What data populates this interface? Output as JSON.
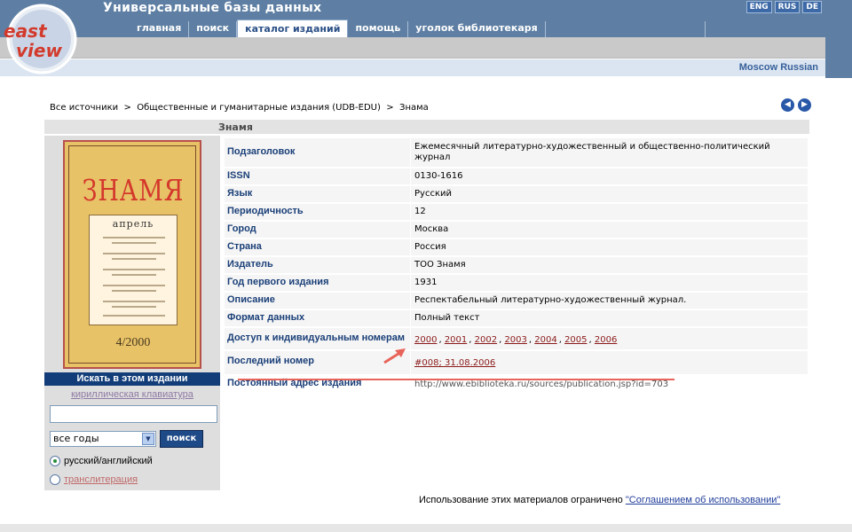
{
  "header": {
    "site_title": "Универсальные базы данных",
    "languages": [
      "ENG",
      "RUS",
      "DE"
    ],
    "nav": [
      "главная",
      "поиск",
      "каталог изданий",
      "помощь",
      "уголок библиотекаря"
    ],
    "active_nav": "каталог изданий",
    "database_label": "Moscow Russian",
    "logo_text": "east view"
  },
  "breadcrumb": {
    "items": [
      "Все источники",
      "Общественные и гуманитарные издания (UDB-EDU)",
      "Знама"
    ],
    "separator": ">"
  },
  "pager": {
    "prev": "◀",
    "next": "▶"
  },
  "publication": {
    "title": "Знамя",
    "cover": {
      "masthead": "ЗНАМЯ",
      "month": "апрель",
      "issue": "4/2000"
    }
  },
  "details": [
    {
      "key": "Подзаголовок",
      "value": "Ежемесячный литературно-художественный и общественно-политический журнал"
    },
    {
      "key": "ISSN",
      "value": "0130-1616"
    },
    {
      "key": "Язык",
      "value": "Русский"
    },
    {
      "key": "Периодичность",
      "value": "12"
    },
    {
      "key": "Город",
      "value": "Москва"
    },
    {
      "key": "Страна",
      "value": "Россия"
    },
    {
      "key": "Издатель",
      "value": "ТОО Знамя"
    },
    {
      "key": "Год первого издания",
      "value": "1931"
    },
    {
      "key": "Описание",
      "value": "Респектабельный литературно-художественный журнал."
    },
    {
      "key": "Формат данных",
      "value": "Полный текст"
    },
    {
      "key": "Доступ к индивидуальным номерам",
      "value": ""
    },
    {
      "key": "Последний номер",
      "value": "#008; 31.08.2006"
    },
    {
      "key": "Постоянный адрес издания",
      "value": "http://www.ebiblioteka.ru/sources/publication.jsp?id=703"
    }
  ],
  "years": [
    "2000",
    "2001",
    "2002",
    "2003",
    "2004",
    "2005",
    "2006"
  ],
  "search_panel": {
    "heading": "Искать в этом издании",
    "keyboard_link": "кириллическая клавиатура",
    "input_value": "",
    "year_select": "все годы",
    "search_button": "поиск",
    "radio_options": [
      "русский/английский",
      "транслитерация"
    ],
    "selected_radio": "русский/английский"
  },
  "footer": {
    "text": "Использование этих материалов ограничено ",
    "link": "\"Соглашением об использовании\""
  },
  "colors": {
    "header_blue": "#5e7fa3",
    "label_blue": "#1a3f78",
    "link_red": "#8b1a1a",
    "annotation_red": "#e8645a"
  }
}
